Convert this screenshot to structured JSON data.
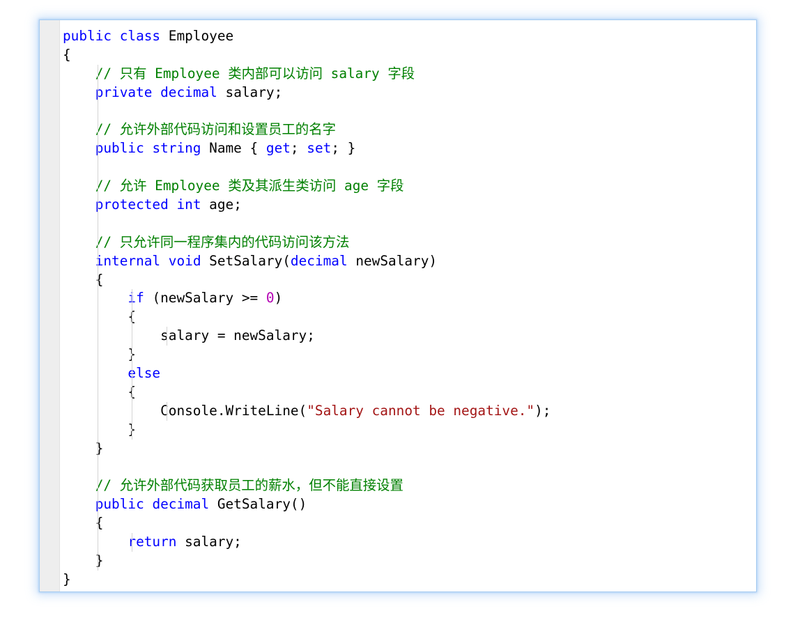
{
  "editor": {
    "language": "C#",
    "background": "#ffffff",
    "gutter_color": "#eeeeee",
    "border_color": "#a8ccf0",
    "glow_color": "#78aff0",
    "colors": {
      "keyword": "#0000ff",
      "comment": "#008000",
      "string": "#a31515",
      "number": "#b300b3",
      "plain": "#000000",
      "indent_guide": "#d4d4d4"
    },
    "lines": [
      {
        "n": 1,
        "indent": 0,
        "tokens": [
          {
            "t": "kw",
            "v": "public"
          },
          {
            "t": "pln",
            "v": " "
          },
          {
            "t": "kw",
            "v": "class"
          },
          {
            "t": "pln",
            "v": " Employee"
          }
        ]
      },
      {
        "n": 2,
        "indent": 0,
        "tokens": [
          {
            "t": "pln",
            "v": "{"
          }
        ]
      },
      {
        "n": 3,
        "indent": 1,
        "tokens": [
          {
            "t": "cmt",
            "v": "// 只有 Employee 类内部可以访问 salary 字段"
          }
        ]
      },
      {
        "n": 4,
        "indent": 1,
        "tokens": [
          {
            "t": "kw",
            "v": "private"
          },
          {
            "t": "pln",
            "v": " "
          },
          {
            "t": "kw",
            "v": "decimal"
          },
          {
            "t": "pln",
            "v": " salary;"
          }
        ]
      },
      {
        "n": 5,
        "indent": 1,
        "tokens": []
      },
      {
        "n": 6,
        "indent": 1,
        "tokens": [
          {
            "t": "cmt",
            "v": "// 允许外部代码访问和设置员工的名字"
          }
        ]
      },
      {
        "n": 7,
        "indent": 1,
        "tokens": [
          {
            "t": "kw",
            "v": "public"
          },
          {
            "t": "pln",
            "v": " "
          },
          {
            "t": "kw",
            "v": "string"
          },
          {
            "t": "pln",
            "v": " Name { "
          },
          {
            "t": "kw",
            "v": "get"
          },
          {
            "t": "pln",
            "v": "; "
          },
          {
            "t": "kw",
            "v": "set"
          },
          {
            "t": "pln",
            "v": "; }"
          }
        ]
      },
      {
        "n": 8,
        "indent": 1,
        "tokens": []
      },
      {
        "n": 9,
        "indent": 1,
        "tokens": [
          {
            "t": "cmt",
            "v": "// 允许 Employee 类及其派生类访问 age 字段"
          }
        ]
      },
      {
        "n": 10,
        "indent": 1,
        "tokens": [
          {
            "t": "kw",
            "v": "protected"
          },
          {
            "t": "pln",
            "v": " "
          },
          {
            "t": "kw",
            "v": "int"
          },
          {
            "t": "pln",
            "v": " age;"
          }
        ]
      },
      {
        "n": 11,
        "indent": 1,
        "tokens": []
      },
      {
        "n": 12,
        "indent": 1,
        "tokens": [
          {
            "t": "cmt",
            "v": "// 只允许同一程序集内的代码访问该方法"
          }
        ]
      },
      {
        "n": 13,
        "indent": 1,
        "tokens": [
          {
            "t": "kw",
            "v": "internal"
          },
          {
            "t": "pln",
            "v": " "
          },
          {
            "t": "kw",
            "v": "void"
          },
          {
            "t": "pln",
            "v": " SetSalary("
          },
          {
            "t": "kw",
            "v": "decimal"
          },
          {
            "t": "pln",
            "v": " newSalary)"
          }
        ]
      },
      {
        "n": 14,
        "indent": 1,
        "tokens": [
          {
            "t": "pln",
            "v": "{"
          }
        ]
      },
      {
        "n": 15,
        "indent": 2,
        "tokens": [
          {
            "t": "kw",
            "v": "if"
          },
          {
            "t": "pln",
            "v": " (newSalary >= "
          },
          {
            "t": "num",
            "v": "0"
          },
          {
            "t": "pln",
            "v": ")"
          }
        ]
      },
      {
        "n": 16,
        "indent": 2,
        "tokens": [
          {
            "t": "pln",
            "v": "{"
          }
        ]
      },
      {
        "n": 17,
        "indent": 3,
        "tokens": [
          {
            "t": "pln",
            "v": "salary = newSalary;"
          }
        ]
      },
      {
        "n": 18,
        "indent": 2,
        "tokens": [
          {
            "t": "pln",
            "v": "}"
          }
        ]
      },
      {
        "n": 19,
        "indent": 2,
        "tokens": [
          {
            "t": "kw",
            "v": "else"
          }
        ]
      },
      {
        "n": 20,
        "indent": 2,
        "tokens": [
          {
            "t": "pln",
            "v": "{"
          }
        ]
      },
      {
        "n": 21,
        "indent": 3,
        "tokens": [
          {
            "t": "pln",
            "v": "Console.WriteLine("
          },
          {
            "t": "str",
            "v": "\"Salary cannot be negative.\""
          },
          {
            "t": "pln",
            "v": ");"
          }
        ]
      },
      {
        "n": 22,
        "indent": 2,
        "tokens": [
          {
            "t": "pln",
            "v": "}"
          }
        ]
      },
      {
        "n": 23,
        "indent": 1,
        "tokens": [
          {
            "t": "pln",
            "v": "}"
          }
        ]
      },
      {
        "n": 24,
        "indent": 1,
        "tokens": []
      },
      {
        "n": 25,
        "indent": 1,
        "tokens": [
          {
            "t": "cmt",
            "v": "// 允许外部代码获取员工的薪水，但不能直接设置"
          }
        ]
      },
      {
        "n": 26,
        "indent": 1,
        "tokens": [
          {
            "t": "kw",
            "v": "public"
          },
          {
            "t": "pln",
            "v": " "
          },
          {
            "t": "kw",
            "v": "decimal"
          },
          {
            "t": "pln",
            "v": " GetSalary()"
          }
        ]
      },
      {
        "n": 27,
        "indent": 1,
        "tokens": [
          {
            "t": "pln",
            "v": "{"
          }
        ]
      },
      {
        "n": 28,
        "indent": 2,
        "tokens": [
          {
            "t": "kw",
            "v": "return"
          },
          {
            "t": "pln",
            "v": " salary;"
          }
        ]
      },
      {
        "n": 29,
        "indent": 1,
        "tokens": [
          {
            "t": "pln",
            "v": "}"
          }
        ]
      },
      {
        "n": 30,
        "indent": 0,
        "tokens": [
          {
            "t": "pln",
            "v": "}"
          }
        ]
      }
    ]
  }
}
